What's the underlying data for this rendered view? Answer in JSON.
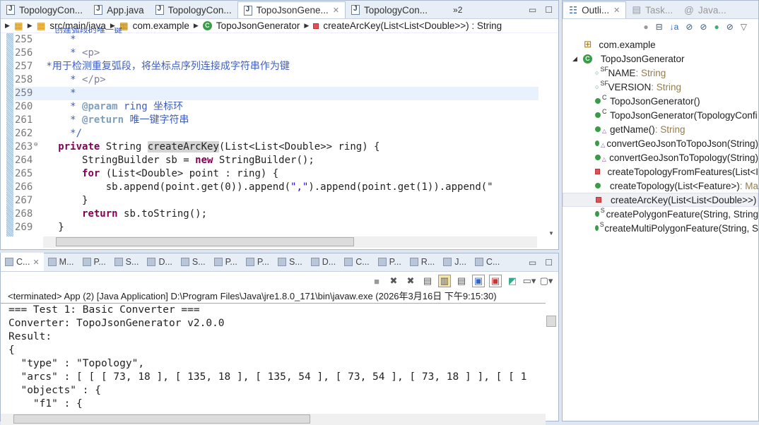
{
  "editor": {
    "tabs": [
      {
        "label": "TopologyCon..."
      },
      {
        "label": "App.java"
      },
      {
        "label": "TopologyCon..."
      },
      {
        "label": "TopoJsonGene...",
        "active": true
      },
      {
        "label": "TopologyCon..."
      }
    ],
    "overflow": "»2",
    "breadcrumb": [
      "src/main/java",
      "com.example",
      "TopoJsonGenerator",
      "createArcKey(List<List<Double>>) : String"
    ],
    "partial_line": "创建弧段的唯一键",
    "lines": [
      {
        "n": "255",
        "t": [
          [
            "cm",
            "     *"
          ]
        ]
      },
      {
        "n": "256",
        "t": [
          [
            "cm",
            "     * "
          ],
          [
            "tg",
            "<p>"
          ]
        ]
      },
      {
        "n": "257",
        "t": [
          [
            "cm",
            " *用于检测重复弧段，将坐标点序列连接成字符串作为键"
          ]
        ]
      },
      {
        "n": "258",
        "t": [
          [
            "cm",
            "     * "
          ],
          [
            "tg",
            "</p>"
          ]
        ]
      },
      {
        "n": "259",
        "t": [
          [
            "cm",
            "     *"
          ]
        ],
        "hl": true
      },
      {
        "n": "260",
        "t": [
          [
            "cm",
            "     * "
          ],
          [
            "at",
            "@param"
          ],
          [
            "cm",
            " ring 坐标环"
          ]
        ]
      },
      {
        "n": "261",
        "t": [
          [
            "cm",
            "     * "
          ],
          [
            "at",
            "@return"
          ],
          [
            "cm",
            " 唯一键字符串"
          ]
        ]
      },
      {
        "n": "262",
        "t": [
          [
            "cm",
            "     */"
          ]
        ]
      },
      {
        "n": "263",
        "t": [
          [
            "",
            "   "
          ],
          [
            "kw",
            "private"
          ],
          [
            "",
            " String "
          ],
          [
            "mk",
            "createArcKey"
          ],
          [
            "",
            "(List<List<Double>> ring) {"
          ]
        ]
      },
      {
        "n": "264",
        "t": [
          [
            "",
            "       StringBuilder sb = "
          ],
          [
            "kw",
            "new"
          ],
          [
            "",
            " StringBuilder();"
          ]
        ]
      },
      {
        "n": "265",
        "t": [
          [
            "",
            "       "
          ],
          [
            "kw",
            "for"
          ],
          [
            "",
            " (List<Double> point : ring) {"
          ]
        ]
      },
      {
        "n": "266",
        "t": [
          [
            "",
            "           sb.append(point.get(0)).append("
          ],
          [
            "st",
            "\",\""
          ],
          [
            "",
            ").append(point.get(1)).append(\""
          ]
        ]
      },
      {
        "n": "267",
        "t": [
          [
            "",
            "       }"
          ]
        ]
      },
      {
        "n": "268",
        "t": [
          [
            "",
            "       "
          ],
          [
            "kw",
            "return"
          ],
          [
            "",
            " sb.toString();"
          ]
        ]
      },
      {
        "n": "269",
        "t": [
          [
            "",
            "   }"
          ]
        ]
      }
    ]
  },
  "console": {
    "tabs": [
      "C...",
      "M...",
      "P...",
      "S...",
      "D...",
      "S...",
      "P...",
      "P...",
      "S...",
      "D...",
      "C...",
      "P...",
      "R...",
      "J...",
      "C..."
    ],
    "status": "<terminated> App (2) [Java Application] D:\\Program Files\\Java\\jre1.8.0_171\\bin\\javaw.exe (2026年3月16日 下午9:15:30)",
    "output": [
      "=== Test 1: Basic Converter ===",
      "Converter: TopoJsonGenerator v2.0.0",
      "Result:",
      "{",
      "  \"type\" : \"Topology\",",
      "  \"arcs\" : [ [ [ 73, 18 ], [ 135, 18 ], [ 135, 54 ], [ 73, 54 ], [ 73, 18 ] ], [ [ 1",
      "  \"objects\" : {",
      "    \"f1\" : {"
    ]
  },
  "outline": {
    "tabs": [
      "Outli...",
      "Task...",
      "Java..."
    ],
    "package": "com.example",
    "class": "TopoJsonGenerator",
    "members": [
      {
        "name": "NAME",
        "type": " : String",
        "icon": "field",
        "mod": "SF"
      },
      {
        "name": "VERSION",
        "type": " : String",
        "icon": "field",
        "mod": "SF"
      },
      {
        "name": "TopoJsonGenerator()",
        "type": "",
        "icon": "public",
        "mod": "C"
      },
      {
        "name": "TopoJsonGenerator(TopologyConfi",
        "type": "",
        "icon": "public",
        "mod": "C"
      },
      {
        "name": "getName()",
        "type": " : String",
        "icon": "public",
        "mod": "△"
      },
      {
        "name": "convertGeoJsonToTopoJson(String)",
        "type": "",
        "icon": "public",
        "mod": "△"
      },
      {
        "name": "convertGeoJsonToTopology(String)",
        "type": "",
        "icon": "public",
        "mod": "△"
      },
      {
        "name": "createTopologyFromFeatures(List<I",
        "type": "",
        "icon": "private",
        "mod": ""
      },
      {
        "name": "createTopology(List<Feature>)",
        "type": " : Ma",
        "icon": "public",
        "mod": ""
      },
      {
        "name": "createArcKey(List<List<Double>>)",
        "type": "",
        "icon": "private",
        "mod": "",
        "selected": true
      },
      {
        "name": "createPolygonFeature(String, String",
        "type": "",
        "icon": "public",
        "mod": "S"
      },
      {
        "name": "createMultiPolygonFeature(String, S",
        "type": "",
        "icon": "public",
        "mod": "S"
      }
    ]
  }
}
